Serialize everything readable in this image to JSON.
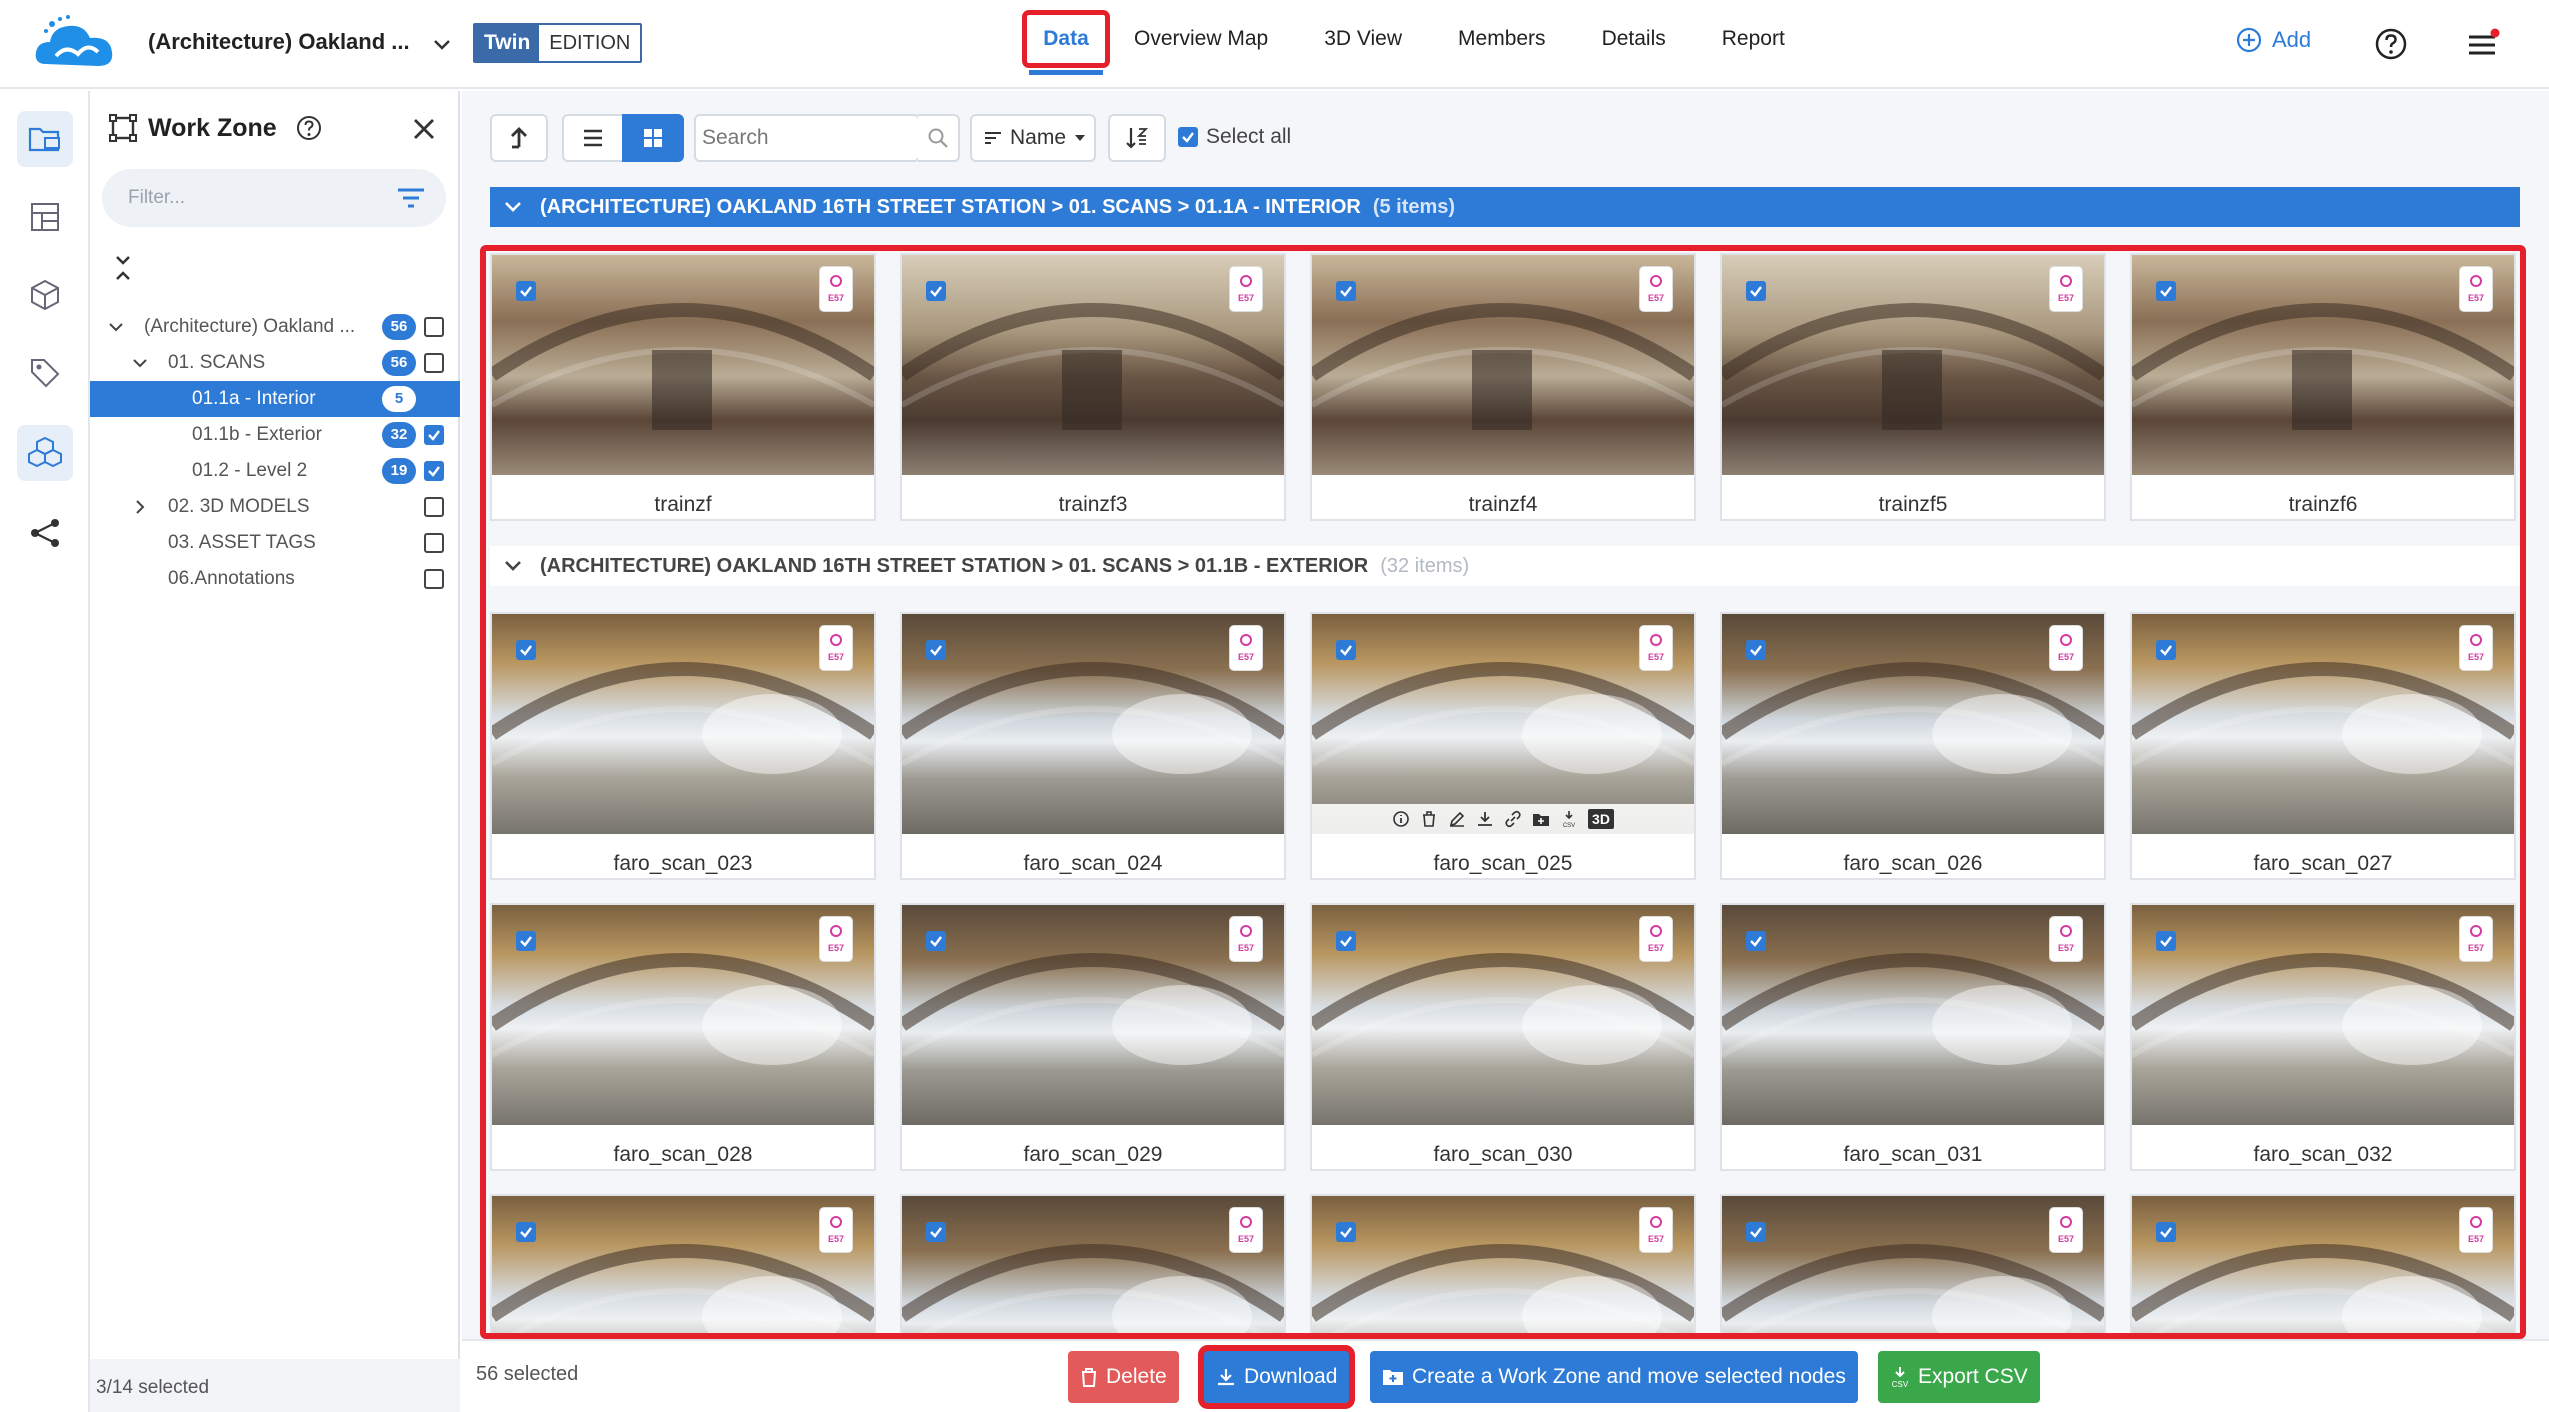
{
  "header": {
    "project_title": "(Architecture) Oakland ...",
    "edition_twin": "Twin",
    "edition_label": "EDITION",
    "tabs": [
      "Data",
      "Overview Map",
      "3D View",
      "Members",
      "Details",
      "Report"
    ],
    "active_tab": "Data",
    "add_label": "Add"
  },
  "colors": {
    "accent": "#2d7bd6",
    "highlight": "#e5202a",
    "delete": "#e35a5a",
    "export": "#3aa84a"
  },
  "work_zone": {
    "title": "Work Zone",
    "filter_placeholder": "Filter...",
    "tree": [
      {
        "label": "(Architecture) Oakland ...",
        "badge": "56",
        "checked": false,
        "level": 0,
        "expanded": true
      },
      {
        "label": "01. SCANS",
        "badge": "56",
        "checked": false,
        "level": 1,
        "expanded": true
      },
      {
        "label": "01.1a - Interior",
        "badge": "5",
        "checked": false,
        "level": 2,
        "selected": true
      },
      {
        "label": "01.1b - Exterior",
        "badge": "32",
        "checked": true,
        "level": 2
      },
      {
        "label": "01.2 - Level 2",
        "badge": "19",
        "checked": true,
        "level": 2
      },
      {
        "label": "02. 3D MODELS",
        "badge": "",
        "checked": false,
        "level": 1,
        "collapsed": true
      },
      {
        "label": "03. ASSET TAGS",
        "badge": "",
        "checked": false,
        "level": 1
      },
      {
        "label": "06.Annotations",
        "badge": "",
        "checked": false,
        "level": 1
      }
    ],
    "footer_status": "3/14 selected"
  },
  "toolbar": {
    "search_placeholder": "Search",
    "sort_label": "Name",
    "select_all_label": "Select all"
  },
  "sections": [
    {
      "path": "(ARCHITECTURE) OAKLAND 16TH STREET STATION > 01. SCANS > 01.1A - INTERIOR",
      "count": "(5 items)",
      "items": [
        "trainzf",
        "trainzf3",
        "trainzf4",
        "trainzf5",
        "trainzf6"
      ]
    },
    {
      "path": "(ARCHITECTURE) OAKLAND 16TH STREET STATION > 01. SCANS > 01.1B - EXTERIOR",
      "count": "(32 items)",
      "items": [
        "faro_scan_023",
        "faro_scan_024",
        "faro_scan_025",
        "faro_scan_026",
        "faro_scan_027",
        "faro_scan_028",
        "faro_scan_029",
        "faro_scan_030",
        "faro_scan_031",
        "faro_scan_032"
      ]
    }
  ],
  "badge_e57": "E57",
  "action_3d_label": "3D",
  "action_csv_label": "CSV",
  "footer": {
    "selected_count": "56 selected",
    "delete_label": "Delete",
    "download_label": "Download",
    "workzone_label": "Create a Work Zone and move selected nodes",
    "export_label": "Export CSV"
  }
}
